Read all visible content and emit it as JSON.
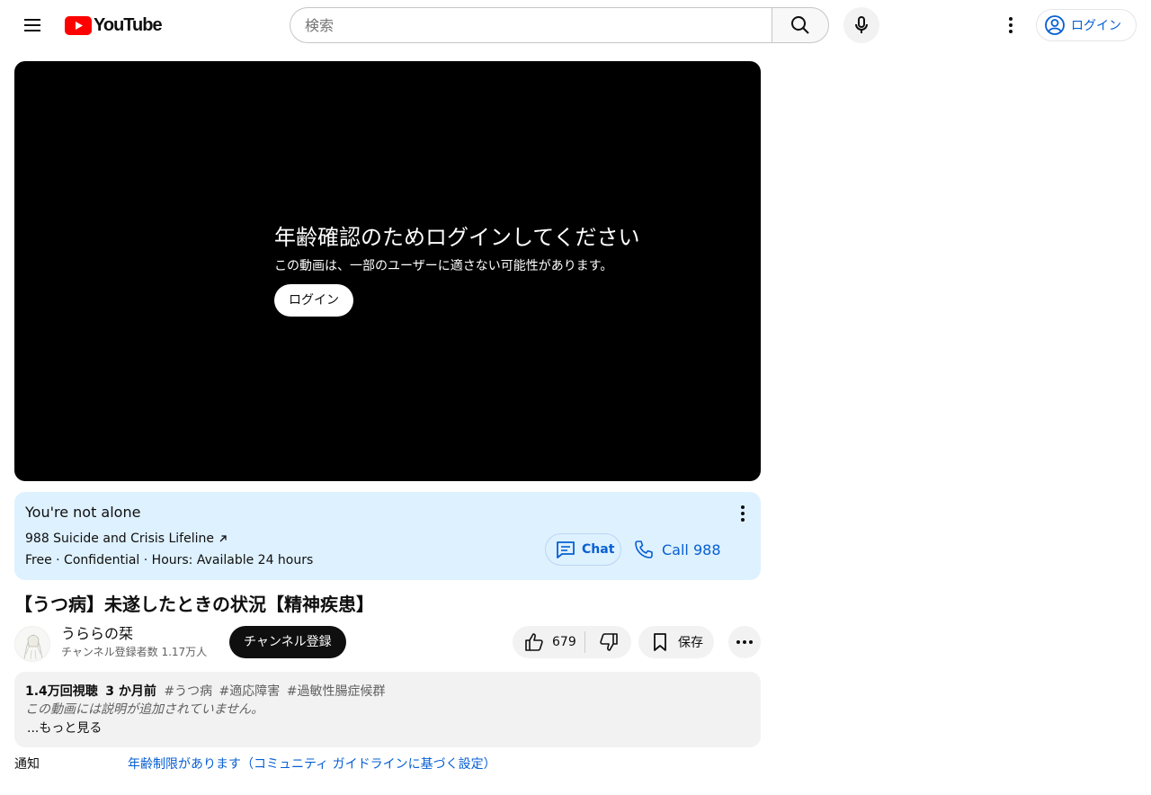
{
  "header": {
    "logo_text": "YouTube",
    "search_placeholder": "検索",
    "login_label": "ログイン"
  },
  "player": {
    "gate_title": "年齢確認のためログインしてください",
    "gate_subtitle": "この動画は、一部のユーザーに適さない可能性があります。",
    "gate_login_label": "ログイン"
  },
  "crisis": {
    "title": "You're not alone",
    "org": "988 Suicide and Crisis Lifeline",
    "info": "Free · Confidential · Hours: Available 24 hours",
    "chat_label": "Chat",
    "call_label": "Call 988"
  },
  "video": {
    "title": "【うつ病】未遂したときの状況【精神疾患】"
  },
  "owner": {
    "channel_name": "うららの栞",
    "subscriber_count": "チャンネル登録者数 1.17万人",
    "subscribe_label": "チャンネル登録"
  },
  "actions": {
    "like_count": "679",
    "save_label": "保存"
  },
  "description": {
    "views": "1.4万回視聴",
    "date": "3 か月前",
    "tags": [
      "#うつ病",
      "#適応障害",
      "#過敏性腸症候群"
    ],
    "text": "この動画には説明が追加されていません。",
    "more_label": "...もっと見る"
  },
  "notice": {
    "label": "通知",
    "link": "年齢制限があります（コミュニティ ガイドラインに基づく設定）"
  },
  "colors": {
    "brand_red": "#ff0000",
    "link_blue": "#065fd4",
    "crisis_bg": "#def1ff"
  }
}
